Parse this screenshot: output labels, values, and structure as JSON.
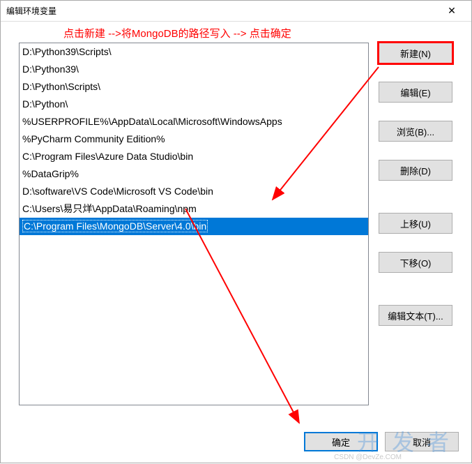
{
  "window": {
    "title": "编辑环境变量"
  },
  "instruction": "点击新建 -->将MongoDB的路径写入 --> 点击确定",
  "path_entries": [
    "D:\\Python39\\Scripts\\",
    "D:\\Python39\\",
    "D:\\Python\\Scripts\\",
    "D:\\Python\\",
    "%USERPROFILE%\\AppData\\Local\\Microsoft\\WindowsApps",
    "%PyCharm Community Edition%",
    "C:\\Program Files\\Azure Data Studio\\bin",
    "%DataGrip%",
    "D:\\software\\VS Code\\Microsoft VS Code\\bin",
    "C:\\Users\\易只烊\\AppData\\Roaming\\npm",
    "C:\\Program Files\\MongoDB\\Server\\4.0\\bin"
  ],
  "selected_index": 10,
  "buttons": {
    "new": "新建(N)",
    "edit": "编辑(E)",
    "browse": "浏览(B)...",
    "delete": "删除(D)",
    "moveup": "上移(U)",
    "movedown": "下移(O)",
    "edittext": "编辑文本(T)...",
    "ok": "确定",
    "cancel": "取消"
  },
  "watermark": {
    "main": "开发者",
    "sub": "CSDN @DevZe.COM"
  }
}
